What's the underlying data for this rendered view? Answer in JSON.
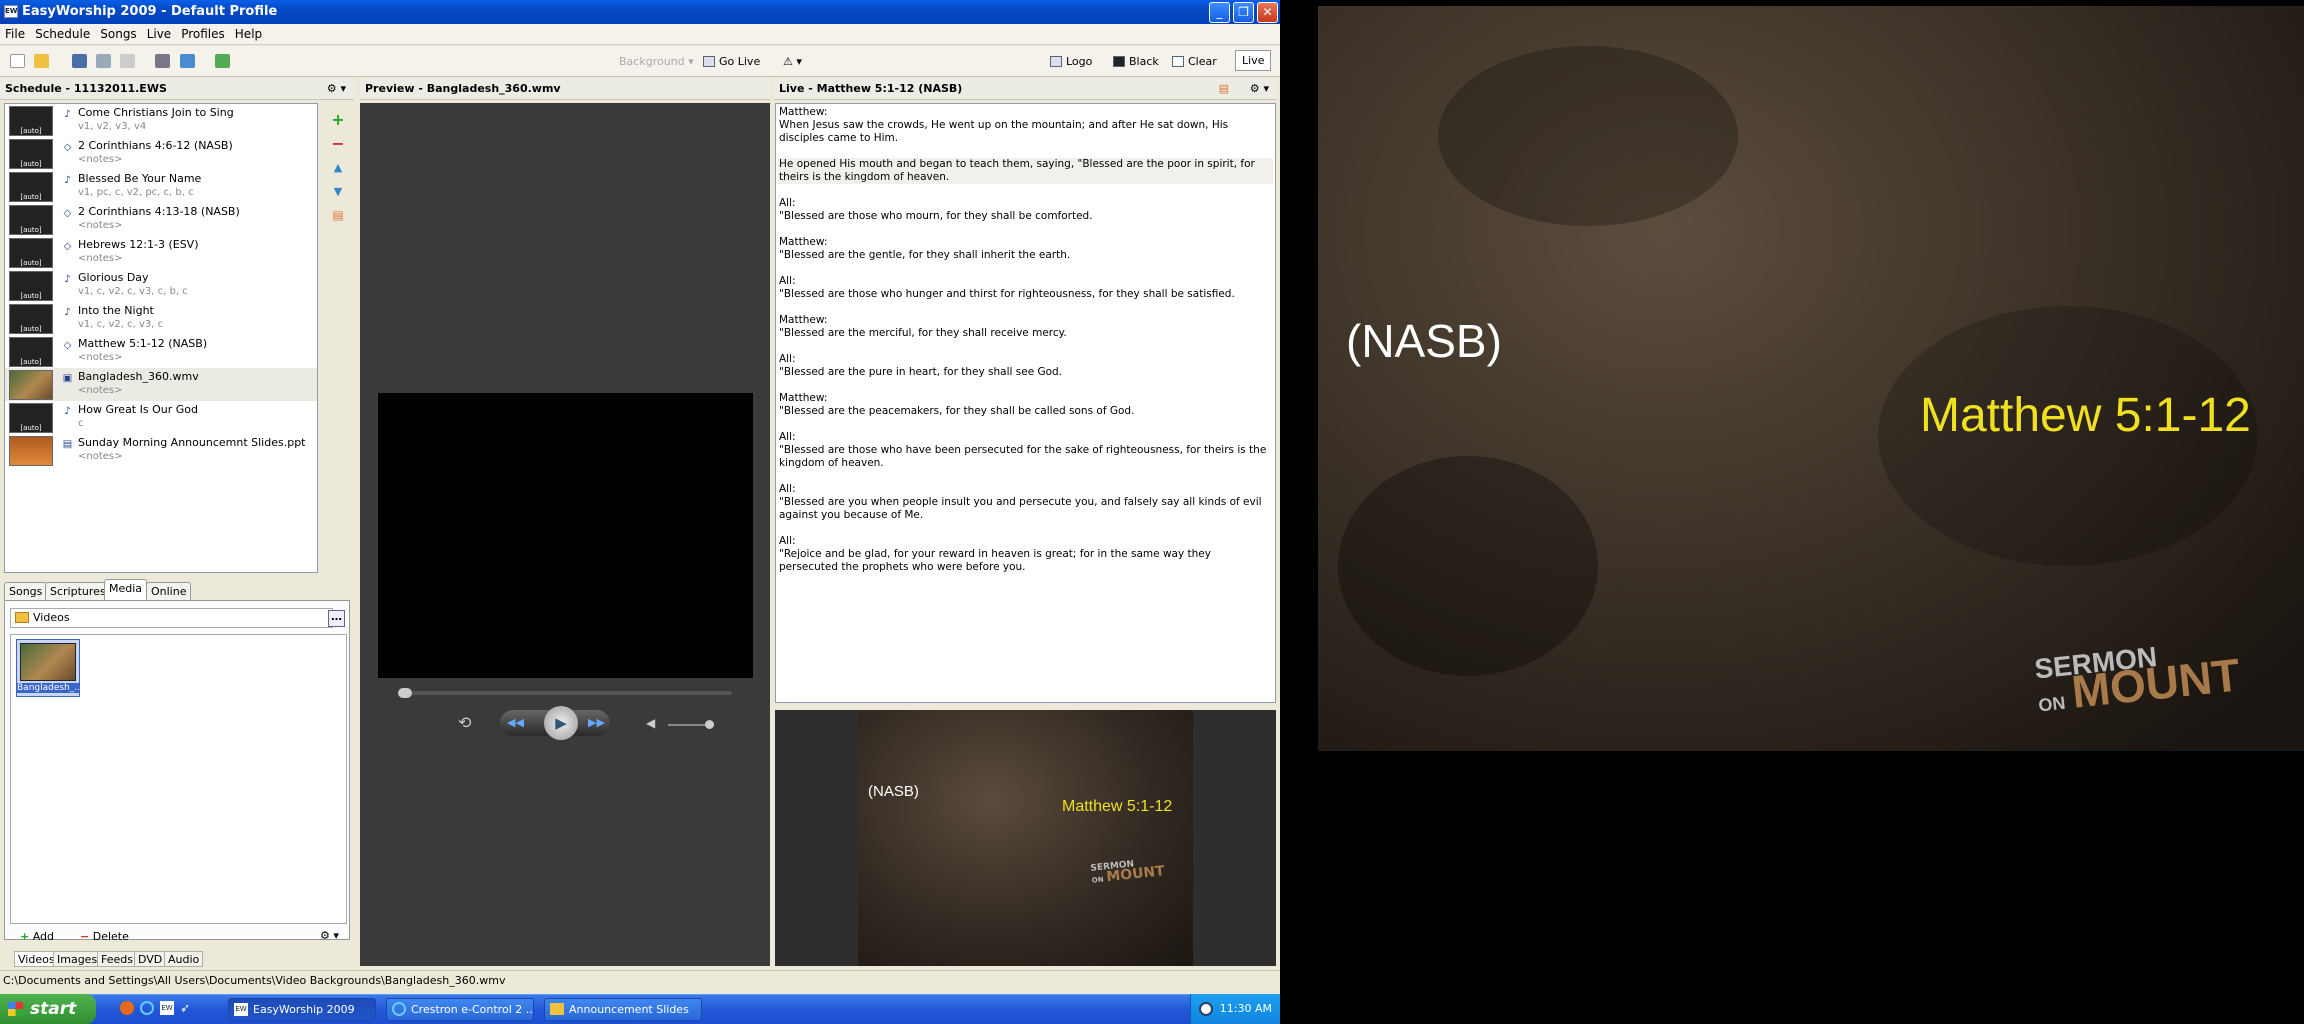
{
  "window": {
    "title": "EasyWorship 2009 - Default Profile",
    "icon_text": "EW"
  },
  "menu": [
    "File",
    "Schedule",
    "Songs",
    "Live",
    "Profiles",
    "Help"
  ],
  "toolbar": {
    "background_label": "Background",
    "go_live_label": "Go Live",
    "logo_label": "Logo",
    "black_label": "Black",
    "clear_label": "Clear",
    "live_label": "Live"
  },
  "schedule": {
    "header": "Schedule - 11132011.EWS",
    "items": [
      {
        "title": "Come Christians Join to Sing",
        "sub": "v1, v2, v3, v4",
        "thumb": "[auto]",
        "type": "song"
      },
      {
        "title": "2 Corinthians 4:6-12 (NASB)",
        "sub": "<notes>",
        "thumb": "[auto]",
        "type": "scripture"
      },
      {
        "title": "Blessed Be Your Name",
        "sub": "v1, pc, c, v2, pc, c, b, c",
        "thumb": "[auto]",
        "type": "song"
      },
      {
        "title": "2 Corinthians 4:13-18 (NASB)",
        "sub": "<notes>",
        "thumb": "[auto]",
        "type": "scripture"
      },
      {
        "title": "Hebrews 12:1-3 (ESV)",
        "sub": "<notes>",
        "thumb": "[auto]",
        "type": "scripture"
      },
      {
        "title": "Glorious Day",
        "sub": "v1, c, v2, c, v3, c, b, c",
        "thumb": "[auto]",
        "type": "song"
      },
      {
        "title": "Into the Night",
        "sub": "v1, c, v2, c, v3, c",
        "thumb": "[auto]",
        "type": "song"
      },
      {
        "title": "Matthew 5:1-12 (NASB)",
        "sub": "<notes>",
        "thumb": "[auto]",
        "type": "scripture"
      },
      {
        "title": "Bangladesh_360.wmv",
        "sub": "<notes>",
        "thumb": "",
        "type": "video"
      },
      {
        "title": "How Great Is Our God",
        "sub": "c",
        "thumb": "[auto]",
        "type": "song"
      },
      {
        "title": "Sunday Morning Announcemnt Slides.ppt",
        "sub": "<notes>",
        "thumb": "",
        "type": "ppt"
      }
    ]
  },
  "tabs": [
    "Songs",
    "Scriptures",
    "Media",
    "Online"
  ],
  "media": {
    "folder": "Videos",
    "thumb_label": "Bangladesh_...",
    "add_label": "Add",
    "delete_label": "Delete",
    "bottom_tabs": [
      "Videos",
      "Images",
      "Feeds",
      "DVD",
      "Audio"
    ]
  },
  "preview": {
    "header": "Preview - Bangladesh_360.wmv"
  },
  "live": {
    "header": "Live - Matthew 5:1-12 (NASB)",
    "paragraphs": [
      "Matthew:\nWhen Jesus saw the crowds, He went up on the mountain; and after He sat down, His disciples came to Him.",
      "He opened His mouth and began to teach them, saying, \"Blessed are the poor in spirit, for theirs is the kingdom of heaven.",
      "All:\n\"Blessed are those who mourn, for they shall be comforted.",
      "Matthew:\n\"Blessed are the gentle, for they shall inherit the earth.",
      "All:\n\"Blessed are those who hunger and thirst for righteousness, for they shall be satisfied.",
      "Matthew:\n\"Blessed are the merciful, for they shall receive mercy.",
      "All:\n\"Blessed are the pure in heart, for they shall see God.",
      "Matthew:\n\"Blessed are the peacemakers, for they shall be called sons of God.",
      "All:\n\"Blessed are those who have been persecuted for the sake of righteousness, for theirs is the kingdom of heaven.",
      "All:\n\"Blessed are you when people insult you and persecute you, and falsely say all kinds of evil against you because of Me.",
      "All:\n\"Rejoice and be glad, for your reward in heaven is great; for in the same way they persecuted the prophets who were before you."
    ]
  },
  "slide": {
    "version": "(NASB)",
    "reference": "Matthew 5:1-12",
    "logo_line1": "SERMON",
    "logo_line2": "ON",
    "logo_line3": "MOUNT",
    "reference_color": "#f0e020"
  },
  "status": {
    "path": "C:\\Documents and Settings\\All Users\\Documents\\Video Backgrounds\\Bangladesh_360.wmv"
  },
  "taskbar": {
    "start": "start",
    "tasks": [
      "EasyWorship 2009",
      "Crestron e-Control 2 ...",
      "Announcement Slides"
    ],
    "clock": "11:30 AM"
  }
}
